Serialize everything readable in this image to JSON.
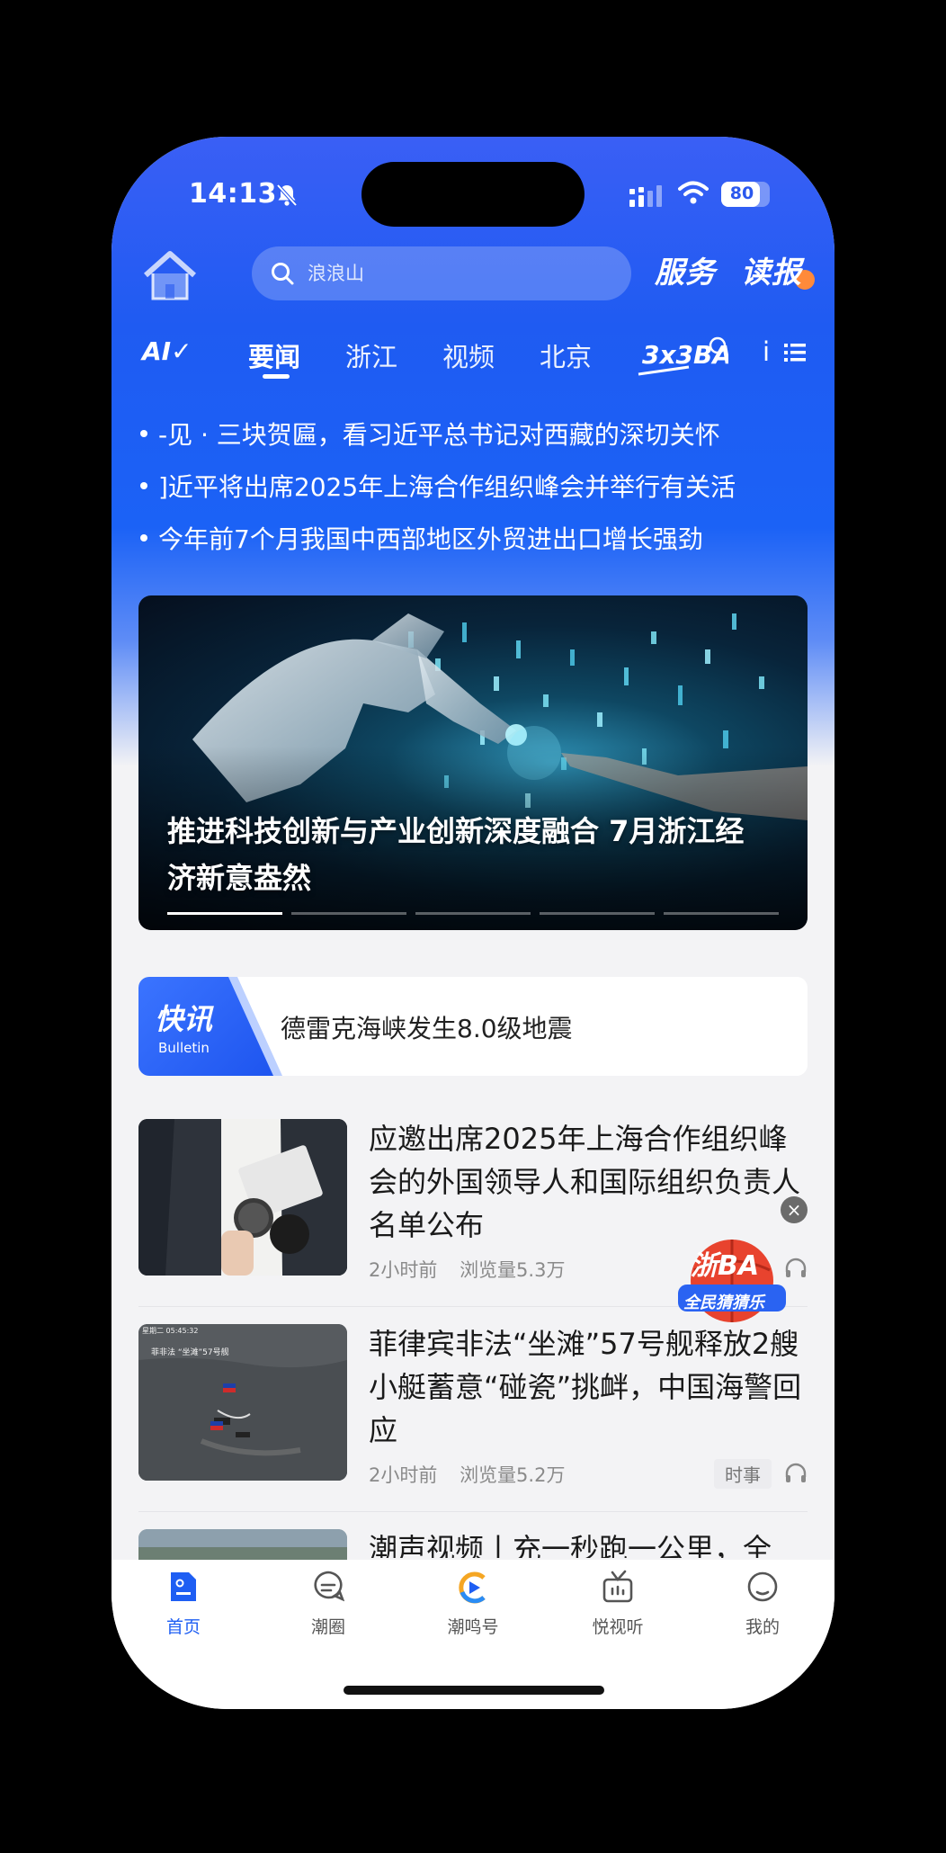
{
  "status": {
    "time": "14:13",
    "battery": "80",
    "battery_level": 0.8
  },
  "header": {
    "search_placeholder": "浪浪山",
    "service_label": "服务",
    "paper_label": "读报"
  },
  "tabs": {
    "ai": "AI",
    "items": [
      "要闻",
      "浙江",
      "视频",
      "北京"
    ],
    "logo_text": "3x3BA",
    "more_partial": "i"
  },
  "headlines": [
    "-见 · 三块贺匾，看习近平总书记对西藏的深切关怀",
    "]近平将出席2025年上海合作组织峰会并举行有关活",
    "今年前7个月我国中西部地区外贸进出口增长强劲"
  ],
  "carousel": {
    "title": "推进科技创新与产业创新深度融合 7月浙江经济新意盎然",
    "slide_count": 5,
    "active_index": 0
  },
  "bulletin": {
    "label_cn": "快讯",
    "label_en": "Bulletin",
    "text": "德雷克海峡发生8.0级地震"
  },
  "news": [
    {
      "title": "应邀出席2025年上海合作组织峰会的外国领导人和国际组织负责人名单公布",
      "time": "2小时前",
      "views": "浏览量5.3万",
      "tag": ""
    },
    {
      "title": "菲律宾非法“坐滩”57号舰释放2艘小艇蓄意“碰瓷”挑衅，中国海警回应",
      "time": "2小时前",
      "views": "浏览量5.2万",
      "tag": "时事",
      "thumb_caption": "菲非法 “坐滩”57号舰",
      "thumb_time": "星期二 05:45:32"
    },
    {
      "title": "潮声视频丨充一秒跑一公里，全",
      "time": "",
      "views": "",
      "tag": ""
    }
  ],
  "float_ad": {
    "line1": "浙BA",
    "line2": "全民猜猜乐",
    "close": "×"
  },
  "tabbar": [
    {
      "label": "首页",
      "icon": "home-doc-icon",
      "active": true
    },
    {
      "label": "潮圈",
      "icon": "chat-bubble-icon",
      "active": false
    },
    {
      "label": "潮鸣号",
      "icon": "chaoming-logo-icon",
      "active": false
    },
    {
      "label": "悦视听",
      "icon": "tv-icon",
      "active": false
    },
    {
      "label": "我的",
      "icon": "profile-icon",
      "active": false
    }
  ],
  "colors": {
    "brand_blue": "#1e5ef3",
    "header_gradient_top": "#3a5ff5"
  }
}
